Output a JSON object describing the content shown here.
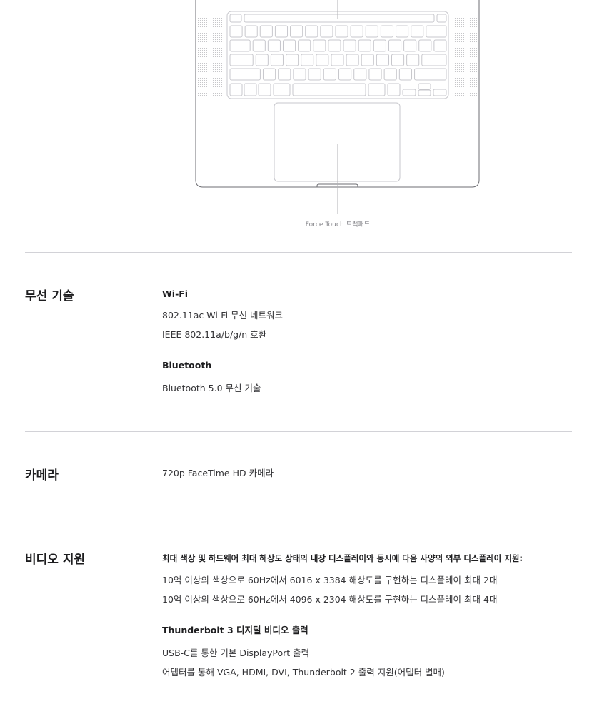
{
  "diagram": {
    "trackpad_label": "Force Touch 트랙패드"
  },
  "sections": {
    "wireless": {
      "title": "무선 기술",
      "wifi_heading": "Wi-Fi",
      "wifi_lines": [
        "802.11ac Wi-Fi 무선 네트워크",
        "IEEE 802.11a/b/g/n 호환"
      ],
      "bt_heading": "Bluetooth",
      "bt_lines": [
        "Bluetooth 5.0 무선 기술"
      ]
    },
    "camera": {
      "title": "카메라",
      "lines": [
        "720p FaceTime HD 카메라"
      ]
    },
    "video": {
      "title": "비디오 지원",
      "heading": "최대 색상 및 하드웨어 최대 해상도 상태의 내장 디스플레이와 동시에 다음 사양의 외부 디스플레이 지원:",
      "display_lines": [
        "10억 이상의 색상으로 60Hz에서 6016 x 3384 해상도를 구현하는 디스플레이 최대 2대",
        "10억 이상의 색상으로 60Hz에서 4096 x 2304 해상도를 구현하는 디스플레이 최대 4대"
      ],
      "tb_heading": "Thunderbolt 3 디지털 비디오 출력",
      "tb_lines": [
        "USB-C를 통한 기본 DisplayPort 출력",
        "어댑터를 통해 VGA, HDMI, DVI, Thunderbolt 2 출력 지원(어댑터 별매)"
      ]
    }
  }
}
